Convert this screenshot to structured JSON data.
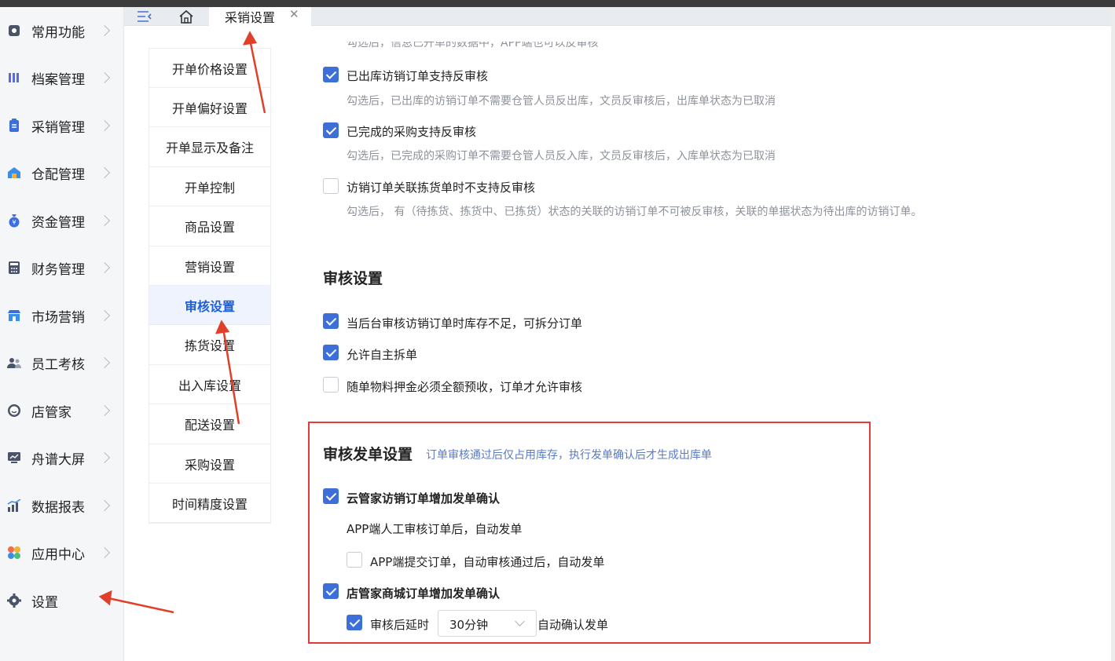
{
  "sidebar": {
    "items": [
      {
        "label": "常用功能",
        "icon": "settings-square-icon"
      },
      {
        "label": "档案管理",
        "icon": "grid-icon"
      },
      {
        "label": "采销管理",
        "icon": "clipboard-icon"
      },
      {
        "label": "仓配管理",
        "icon": "warehouse-icon"
      },
      {
        "label": "资金管理",
        "icon": "money-bag-icon"
      },
      {
        "label": "财务管理",
        "icon": "calculator-icon"
      },
      {
        "label": "市场营销",
        "icon": "store-icon"
      },
      {
        "label": "员工考核",
        "icon": "people-icon"
      },
      {
        "label": "店管家",
        "icon": "smile-icon"
      },
      {
        "label": "舟谱大屏",
        "icon": "monitor-icon"
      },
      {
        "label": "数据报表",
        "icon": "bar-chart-icon"
      },
      {
        "label": "应用中心",
        "icon": "apps-icon"
      },
      {
        "label": "设置",
        "icon": "gear-icon"
      }
    ]
  },
  "tabs": {
    "active_label": "采销设置",
    "close_symbol": "✕"
  },
  "submenu": {
    "items": [
      "开单价格设置",
      "开单偏好设置",
      "开单显示及备注",
      "开单控制",
      "商品设置",
      "营销设置",
      "审核设置",
      "拣货设置",
      "出入库设置",
      "配送设置",
      "采购设置",
      "时间精度设置"
    ],
    "active_index": 6
  },
  "reverse_audit": {
    "options": [
      {
        "label": "已出库访销订单支持反审核",
        "checked": true,
        "hint": "勾选后，已出库的访销订单不需要仓管人员反出库，文员反审核后，出库单状态为已取消"
      },
      {
        "label": "已完成的采购支持反审核",
        "checked": true,
        "hint": "勾选后，已完成的采购订单不需要仓管人员反入库，文员反审核后，入库单状态为已取消"
      },
      {
        "label": "访销订单关联拣货单时不支持反审核",
        "checked": false,
        "hint": "勾选后， 有（待拣货、拣货中、已拣货）状态的关联的访销订单不可被反审核，关联的单据状态为待出库的访销订单。"
      }
    ]
  },
  "audit_settings": {
    "title": "审核设置",
    "options": [
      {
        "label": "当后台审核访销订单时库存不足，可拆分订单",
        "checked": true
      },
      {
        "label": "允许自主拆单",
        "checked": true
      },
      {
        "label": "随单物料押金必须全额预收，订单才允许审核",
        "checked": false
      }
    ]
  },
  "dispatch_settings": {
    "title": "审核发单设置",
    "subtitle": "订单审核通过后仅占用库存，执行发单确认后才生成出库单",
    "cloud_option": {
      "label": "云管家访销订单增加发单确认",
      "checked": true
    },
    "app_manual_text": "APP端人工审核订单后，自动发单",
    "app_submit_option": {
      "label": "APP端提交订单，自动审核通过后，自动发单",
      "checked": false
    },
    "store_option": {
      "label": "店管家商城订单增加发单确认",
      "checked": true
    },
    "delay_option": {
      "label": "审核后延时",
      "checked": true,
      "selected": "30分钟",
      "suffix": "自动确认发单"
    }
  }
}
